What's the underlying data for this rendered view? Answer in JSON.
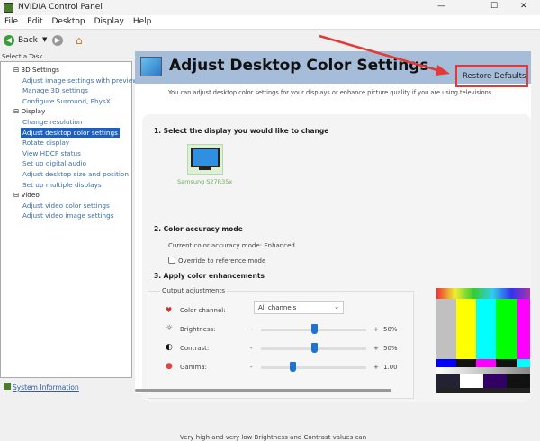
{
  "window": {
    "title": "NVIDIA Control Panel",
    "controls": [
      "—",
      "☐",
      "✕"
    ]
  },
  "menu": [
    "File",
    "Edit",
    "Desktop",
    "Display",
    "Help"
  ],
  "toolbar": {
    "back": "Back"
  },
  "sidebar": {
    "heading": "Select a Task...",
    "groups": [
      {
        "label": "3D Settings",
        "items": [
          "Adjust image settings with preview",
          "Manage 3D settings",
          "Configure Surround, PhysX"
        ]
      },
      {
        "label": "Display",
        "items": [
          "Change resolution",
          "Adjust desktop color settings",
          "Rotate display",
          "View HDCP status",
          "Set up digital audio",
          "Adjust desktop size and position",
          "Set up multiple displays"
        ]
      },
      {
        "label": "Video",
        "items": [
          "Adjust video color settings",
          "Adjust video image settings"
        ]
      }
    ],
    "selected": "Adjust desktop color settings",
    "footer_link": "System Information"
  },
  "page": {
    "title": "Adjust Desktop Color Settings",
    "restore": "Restore Defaults",
    "description": "You can adjust desktop color settings for your displays or enhance picture quality if you are using televisions.",
    "s1": "1. Select the display you would like to change",
    "display_name": "Samsung S27R35x",
    "s2": "2. Color accuracy mode",
    "accuracy": "Current color accuracy mode: Enhanced",
    "override": "Override to reference mode",
    "s3": "3. Apply color enhancements",
    "output": "Output adjustments",
    "channel_label": "Color channel:",
    "channel_value": "All channels",
    "sliders": [
      {
        "label": "Brightness:",
        "value": "50%",
        "level": 0.5
      },
      {
        "label": "Contrast:",
        "value": "50%",
        "level": 0.5
      },
      {
        "label": "Gamma:",
        "value": "1.00",
        "level": 0.3
      }
    ],
    "minus": "-",
    "plus": "+",
    "note": "Very high and very low Brightness and Contrast values can"
  },
  "colors": {
    "accent": "#1a5fc1",
    "header": "#a6bdd9",
    "annotation": "#e53935"
  }
}
